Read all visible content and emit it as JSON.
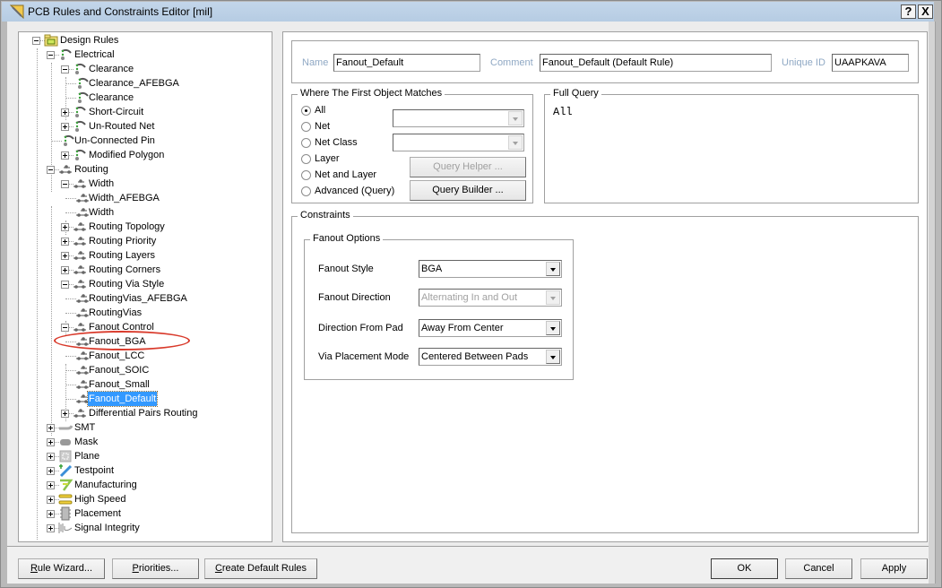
{
  "window": {
    "title": "PCB Rules and Constraints Editor [mil]",
    "help_label": "?",
    "close_label": "X"
  },
  "tree": {
    "items": [
      {
        "label": "Design Rules",
        "icon": "design-rules-folder-icon",
        "level": 0,
        "expander": "minus"
      },
      {
        "label": "Electrical",
        "icon": "electrical-rule-icon",
        "level": 1,
        "expander": "minus"
      },
      {
        "label": "Clearance",
        "icon": "electrical-rule-icon",
        "level": 2,
        "expander": "minus"
      },
      {
        "label": "Clearance_AFEBGA",
        "icon": "electrical-rule-icon",
        "level": 3,
        "expander": "none"
      },
      {
        "label": "Clearance",
        "icon": "electrical-rule-icon",
        "level": 3,
        "expander": "none"
      },
      {
        "label": "Short-Circuit",
        "icon": "electrical-rule-icon",
        "level": 2,
        "expander": "plus"
      },
      {
        "label": "Un-Routed Net",
        "icon": "electrical-rule-icon",
        "level": 2,
        "expander": "plus"
      },
      {
        "label": "Un-Connected Pin",
        "icon": "electrical-rule-icon",
        "level": 2,
        "expander": "none"
      },
      {
        "label": "Modified Polygon",
        "icon": "electrical-rule-icon",
        "level": 2,
        "expander": "plus"
      },
      {
        "label": "Routing",
        "icon": "routing-rule-icon",
        "level": 1,
        "expander": "minus"
      },
      {
        "label": "Width",
        "icon": "routing-rule-icon",
        "level": 2,
        "expander": "minus"
      },
      {
        "label": "Width_AFEBGA",
        "icon": "routing-rule-icon",
        "level": 3,
        "expander": "none"
      },
      {
        "label": "Width",
        "icon": "routing-rule-icon",
        "level": 3,
        "expander": "none"
      },
      {
        "label": "Routing Topology",
        "icon": "routing-rule-icon",
        "level": 2,
        "expander": "plus"
      },
      {
        "label": "Routing Priority",
        "icon": "routing-rule-icon",
        "level": 2,
        "expander": "plus"
      },
      {
        "label": "Routing Layers",
        "icon": "routing-rule-icon",
        "level": 2,
        "expander": "plus"
      },
      {
        "label": "Routing Corners",
        "icon": "routing-rule-icon",
        "level": 2,
        "expander": "plus"
      },
      {
        "label": "Routing Via Style",
        "icon": "routing-rule-icon",
        "level": 2,
        "expander": "minus"
      },
      {
        "label": "RoutingVias_AFEBGA",
        "icon": "routing-rule-icon",
        "level": 3,
        "expander": "none"
      },
      {
        "label": "RoutingVias",
        "icon": "routing-rule-icon",
        "level": 3,
        "expander": "none"
      },
      {
        "label": "Fanout Control",
        "icon": "routing-rule-icon",
        "level": 2,
        "expander": "minus"
      },
      {
        "label": "Fanout_BGA",
        "icon": "routing-rule-icon",
        "level": 3,
        "expander": "none",
        "annotated": true
      },
      {
        "label": "Fanout_LCC",
        "icon": "routing-rule-icon",
        "level": 3,
        "expander": "none"
      },
      {
        "label": "Fanout_SOIC",
        "icon": "routing-rule-icon",
        "level": 3,
        "expander": "none"
      },
      {
        "label": "Fanout_Small",
        "icon": "routing-rule-icon",
        "level": 3,
        "expander": "none"
      },
      {
        "label": "Fanout_Default",
        "icon": "routing-rule-icon",
        "level": 3,
        "expander": "none",
        "selected": true
      },
      {
        "label": "Differential Pairs Routing",
        "icon": "routing-rule-icon",
        "level": 2,
        "expander": "plus"
      },
      {
        "label": "SMT",
        "icon": "smt-rule-icon",
        "level": 1,
        "expander": "plus"
      },
      {
        "label": "Mask",
        "icon": "mask-rule-icon",
        "level": 1,
        "expander": "plus"
      },
      {
        "label": "Plane",
        "icon": "plane-rule-icon",
        "level": 1,
        "expander": "plus"
      },
      {
        "label": "Testpoint",
        "icon": "testpoint-rule-icon",
        "level": 1,
        "expander": "plus"
      },
      {
        "label": "Manufacturing",
        "icon": "manufacturing-rule-icon",
        "level": 1,
        "expander": "plus"
      },
      {
        "label": "High Speed",
        "icon": "high-speed-rule-icon",
        "level": 1,
        "expander": "plus"
      },
      {
        "label": "Placement",
        "icon": "placement-rule-icon",
        "level": 1,
        "expander": "plus"
      },
      {
        "label": "Signal Integrity",
        "icon": "signal-integrity-rule-icon",
        "level": 1,
        "expander": "plus"
      }
    ]
  },
  "rule": {
    "name_label": "Name",
    "name_value": "Fanout_Default",
    "comment_label": "Comment",
    "comment_value": "Fanout_Default (Default Rule)",
    "uid_label": "Unique ID",
    "uid_value": "UAAPKAVA"
  },
  "match": {
    "title": "Where The First Object Matches",
    "options": [
      {
        "label": "All",
        "checked": true
      },
      {
        "label": "Net",
        "checked": false
      },
      {
        "label": "Net Class",
        "checked": false
      },
      {
        "label": "Layer",
        "checked": false
      },
      {
        "label": "Net and Layer",
        "checked": false
      },
      {
        "label": "Advanced (Query)",
        "checked": false
      }
    ],
    "combo1_value": "",
    "combo2_value": "",
    "query_helper_label": "Query Helper ...",
    "query_builder_label": "Query Builder ..."
  },
  "full_query": {
    "title": "Full Query",
    "text": "All"
  },
  "constraints": {
    "title": "Constraints",
    "fanout_options_title": "Fanout Options",
    "fields": [
      {
        "label": "Fanout Style",
        "value": "BGA",
        "disabled": false
      },
      {
        "label": "Fanout Direction",
        "value": "Alternating In and Out",
        "disabled": true
      },
      {
        "label": "Direction From Pad",
        "value": "Away From Center",
        "disabled": false
      },
      {
        "label": "Via Placement Mode",
        "value": "Centered Between Pads",
        "disabled": false
      }
    ]
  },
  "footer": {
    "rule_wizard": {
      "mnemonic": "R",
      "rest": "ule Wizard..."
    },
    "priorities": {
      "mnemonic": "P",
      "rest": "riorities..."
    },
    "create_default": {
      "mnemonic": "C",
      "rest": "reate Default Rules"
    },
    "ok_label": "OK",
    "cancel_label": "Cancel",
    "apply_label": "Apply"
  },
  "colors": {
    "selection": "#3399ff",
    "annotation": "#d93a2b",
    "field_label": "#8fa8c4"
  }
}
